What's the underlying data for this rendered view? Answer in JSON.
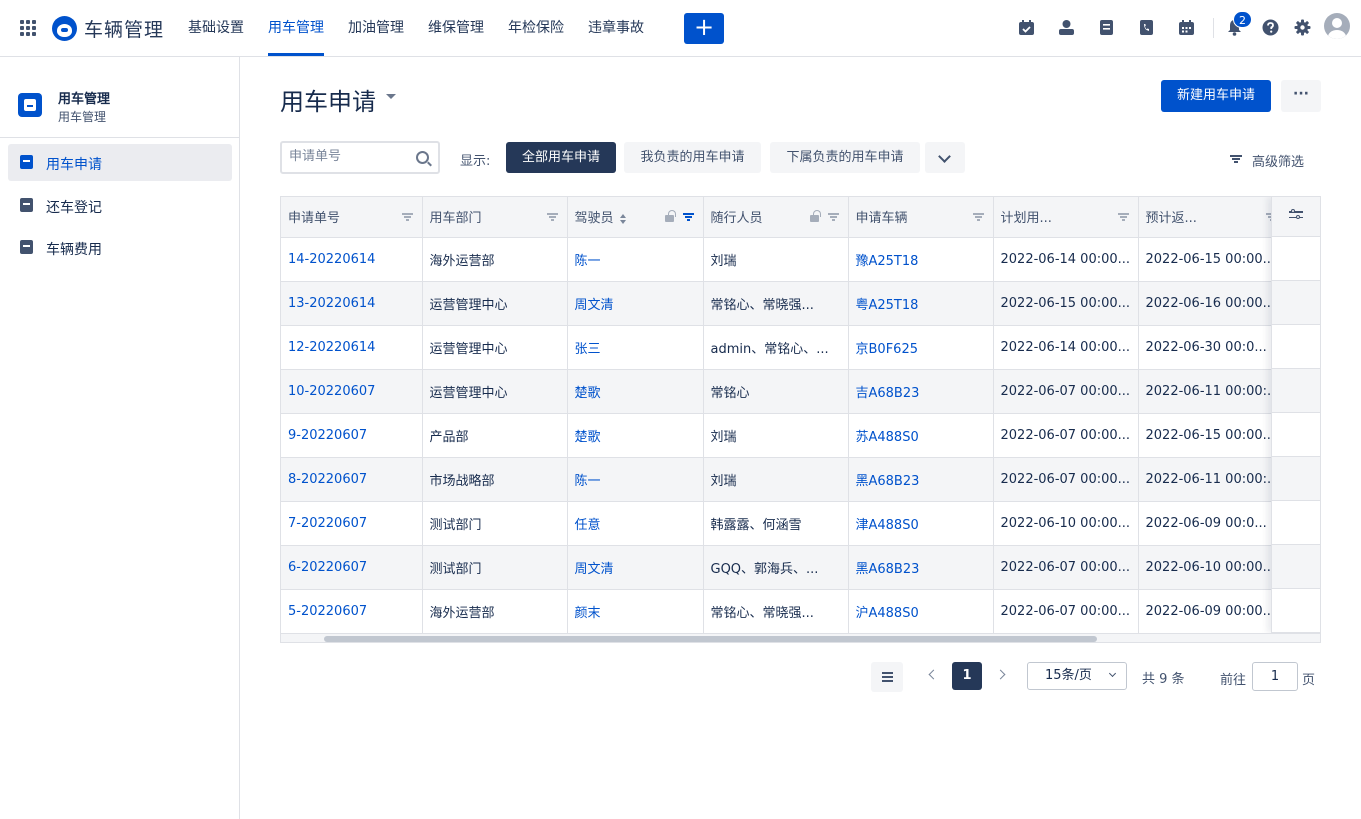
{
  "app": {
    "title": "车辆管理"
  },
  "nav": {
    "items": [
      {
        "label": "基础设置",
        "active": false
      },
      {
        "label": "用车管理",
        "active": true
      },
      {
        "label": "加油管理",
        "active": false
      },
      {
        "label": "维保管理",
        "active": false
      },
      {
        "label": "年检保险",
        "active": false
      },
      {
        "label": "违章事故",
        "active": false
      }
    ],
    "plus_label": "+",
    "notification_count": "2"
  },
  "sidebar": {
    "title": "用车管理",
    "subtitle": "用车管理",
    "items": [
      {
        "label": "用车申请",
        "active": true
      },
      {
        "label": "还车登记",
        "active": false
      },
      {
        "label": "车辆费用",
        "active": false
      }
    ]
  },
  "main": {
    "title": "用车申请",
    "new_button": "新建用车申请",
    "more_button": "···",
    "search_placeholder": "申请单号",
    "show_label": "显示:",
    "filters": [
      "全部用车申请",
      "我负责的用车申请",
      "下属负责的用车申请"
    ],
    "advanced_filter": "高级筛选"
  },
  "table": {
    "columns": [
      "申请单号",
      "用车部门",
      "驾驶员",
      "随行人员",
      "申请车辆",
      "计划用...",
      "预计返..."
    ],
    "rows": [
      [
        "14-20220614",
        "海外运营部",
        "陈一",
        "刘瑞",
        "豫A25T18",
        "2022-06-14 00:00...",
        "2022-06-15 00:00..."
      ],
      [
        "13-20220614",
        "运营管理中心",
        "周文清",
        "常铭心、常晓强...",
        "粤A25T18",
        "2022-06-15 00:00...",
        "2022-06-16 00:00..."
      ],
      [
        "12-20220614",
        "运营管理中心",
        "张三",
        "admin、常铭心、...",
        "京B0F625",
        "2022-06-14 00:00...",
        "2022-06-30 00:0..."
      ],
      [
        "10-20220607",
        "运营管理中心",
        "楚歌",
        "常铭心",
        "吉A68B23",
        "2022-06-07 00:00...",
        "2022-06-11 00:00:..."
      ],
      [
        "9-20220607",
        "产品部",
        "楚歌",
        "刘瑞",
        "苏A488S0",
        "2022-06-07 00:00...",
        "2022-06-15 00:00..."
      ],
      [
        "8-20220607",
        "市场战略部",
        "陈一",
        "刘瑞",
        "黑A68B23",
        "2022-06-07 00:00...",
        "2022-06-11 00:00:..."
      ],
      [
        "7-20220607",
        "测试部门",
        "任意",
        "韩露露、何涵雪",
        "津A488S0",
        "2022-06-10 00:00...",
        "2022-06-09 00:0..."
      ],
      [
        "6-20220607",
        "测试部门",
        "周文清",
        "GQQ、郭海兵、...",
        "黑A68B23",
        "2022-06-07 00:00...",
        "2022-06-10 00:00..."
      ],
      [
        "5-20220607",
        "海外运营部",
        "颜末",
        "常铭心、常晓强...",
        "沪A488S0",
        "2022-06-07 00:00...",
        "2022-06-09 00:00..."
      ]
    ]
  },
  "pagination": {
    "current_page": "1",
    "page_size": "15条/页",
    "total": "共 9 条",
    "goto_label": "前往",
    "goto_value": "1",
    "page_unit": "页"
  },
  "colors": {
    "primary": "#0052cc",
    "dark": "#253858",
    "border": "#dfe1e6",
    "stripe": "#f4f5f7"
  }
}
